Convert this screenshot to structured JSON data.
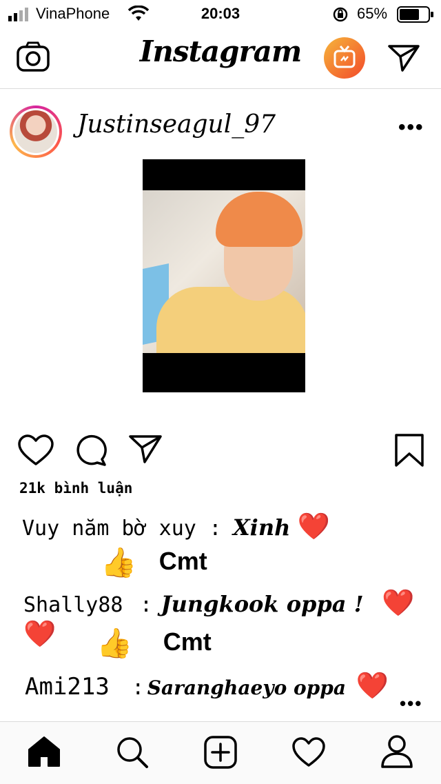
{
  "status_bar": {
    "carrier": "VinaPhone",
    "time": "20:03",
    "battery": "65%"
  },
  "header": {
    "logo": "Instagram",
    "icons": [
      "camera-icon",
      "igtv-icon",
      "direct-message-icon"
    ]
  },
  "post": {
    "username": "Justinseagul_97",
    "more": "•••",
    "stats": "21k bình luận",
    "comments": [
      {
        "user": "Vuy năm bờ xuy",
        "separator": ":",
        "text": "Xinh",
        "emoji": "❤️"
      },
      {
        "marker": "👍",
        "label": "Cmt"
      },
      {
        "user": "Shally88",
        "separator": ":",
        "text": "Jungkook oppa !",
        "emoji": "❤️❤️"
      },
      {
        "marker": "👍",
        "label": "Cmt"
      },
      {
        "user": "Ami213",
        "separator": ":",
        "text": "Saranghaeyo oppa",
        "emoji": "❤️"
      }
    ],
    "more_bottom": "•••"
  },
  "tab_bar": {
    "items": [
      "home-icon",
      "search-icon",
      "new-post-icon",
      "activity-icon",
      "profile-icon"
    ]
  },
  "colors": {
    "heart": "#e21b2c",
    "igtv_gradient": [
      "#f6b53b",
      "#f24a2a"
    ],
    "avatar_ring": [
      "#d6249f",
      "#fdb84c"
    ]
  }
}
